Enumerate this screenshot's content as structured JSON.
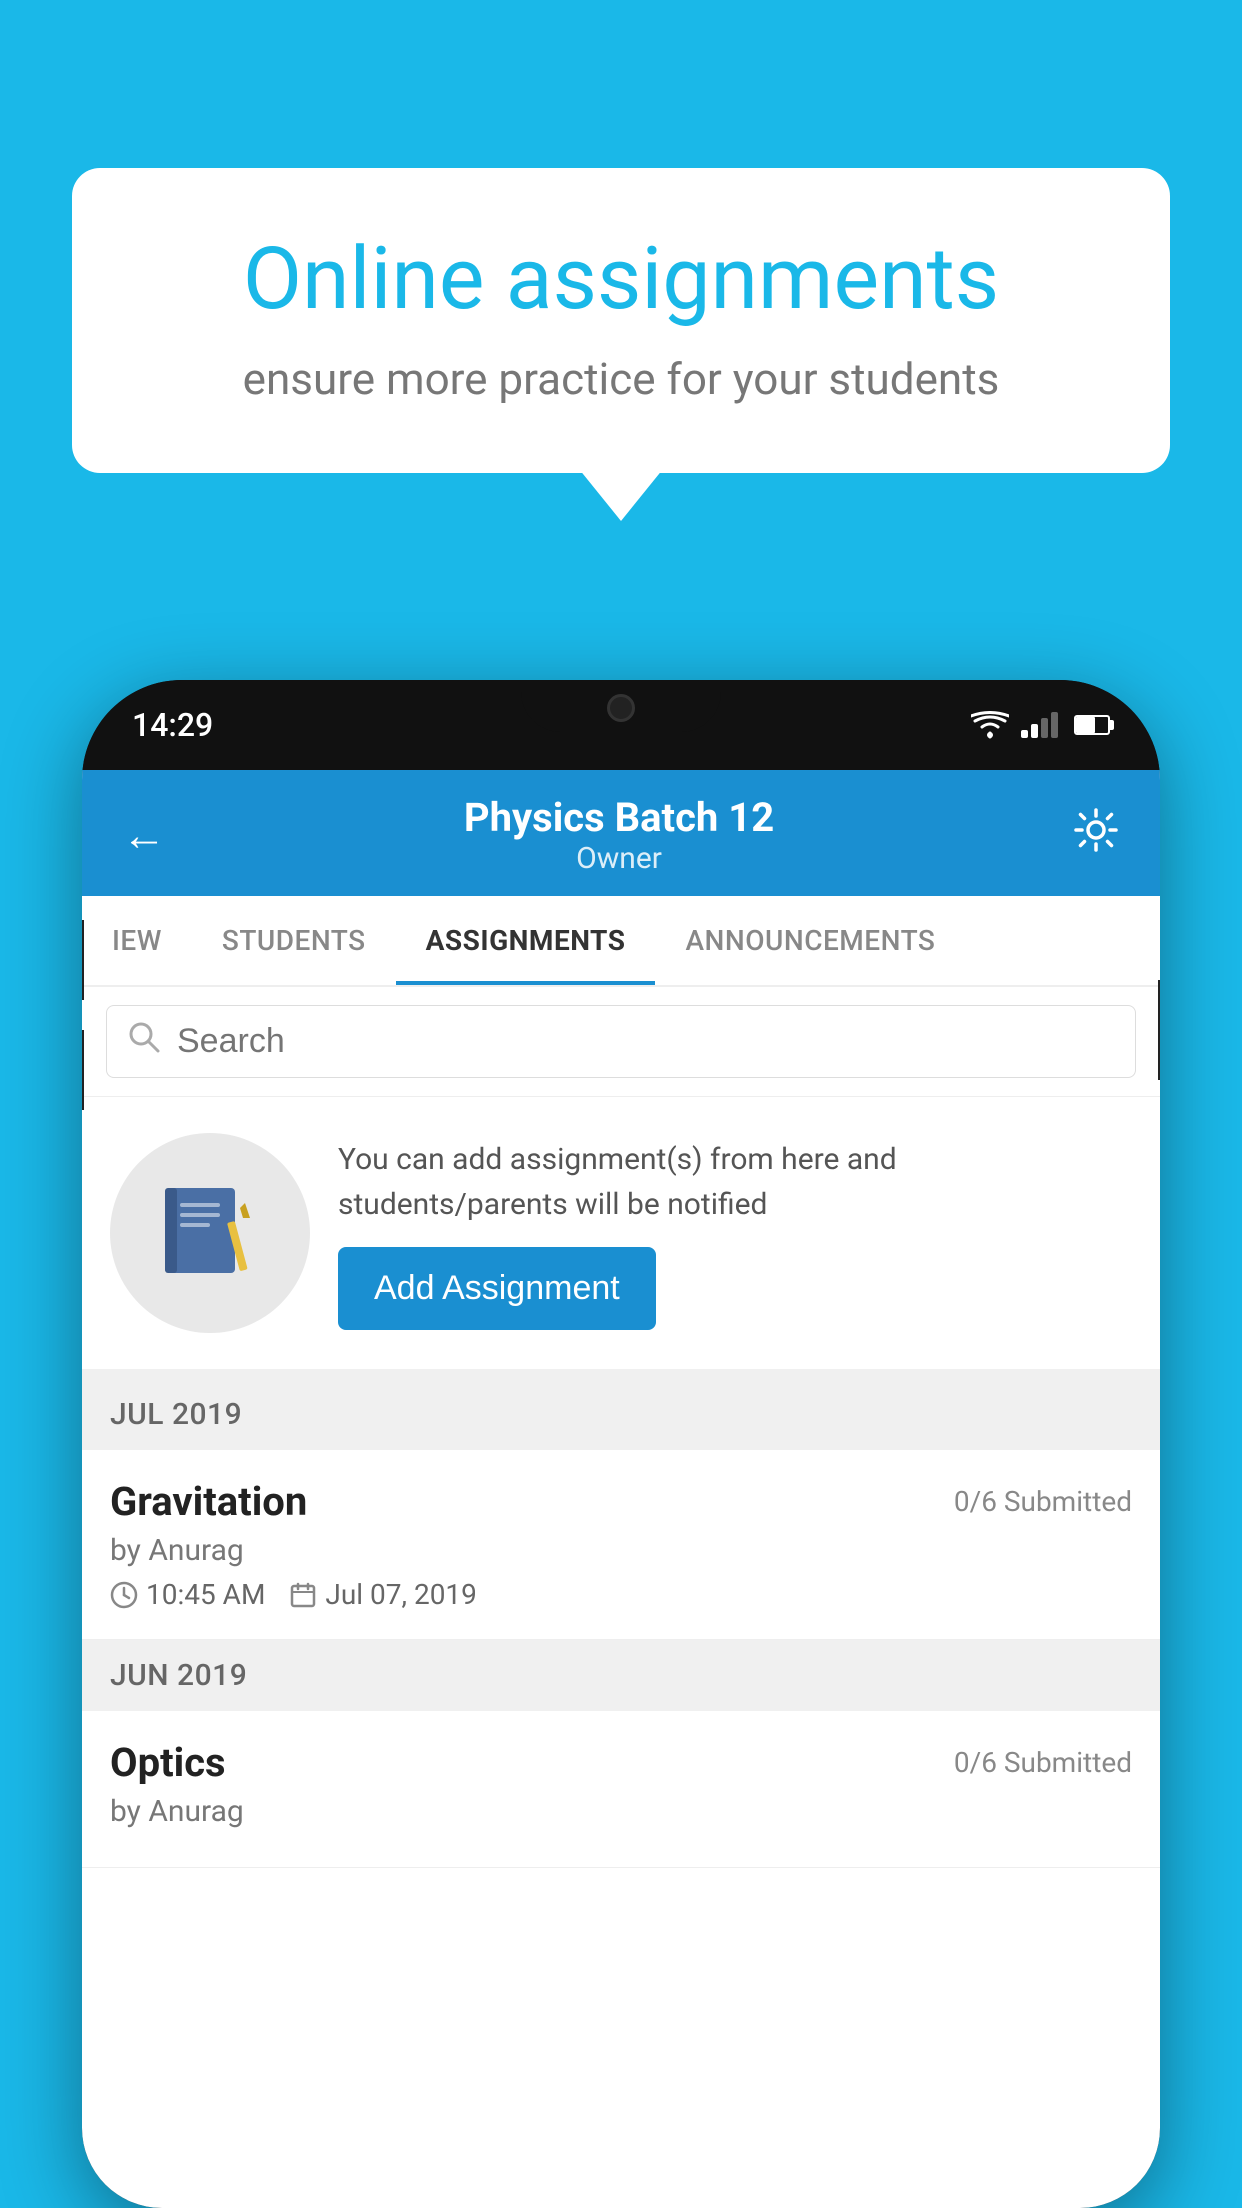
{
  "background_color": "#1ab8e8",
  "speech_bubble": {
    "title": "Online assignments",
    "subtitle": "ensure more practice for your students"
  },
  "phone": {
    "status_bar": {
      "time": "14:29"
    },
    "header": {
      "back_label": "←",
      "title": "Physics Batch 12",
      "subtitle": "Owner",
      "settings_label": "⚙"
    },
    "tabs": [
      {
        "label": "IEW",
        "active": false
      },
      {
        "label": "STUDENTS",
        "active": false
      },
      {
        "label": "ASSIGNMENTS",
        "active": true
      },
      {
        "label": "ANNOUNCEMENTS",
        "active": false
      }
    ],
    "search": {
      "placeholder": "Search"
    },
    "promo": {
      "text": "You can add assignment(s) from here and students/parents will be notified",
      "button_label": "Add Assignment"
    },
    "assignments": [
      {
        "month_label": "JUL 2019",
        "items": [
          {
            "title": "Gravitation",
            "submitted": "0/6 Submitted",
            "author": "by Anurag",
            "time": "10:45 AM",
            "date": "Jul 07, 2019"
          }
        ]
      },
      {
        "month_label": "JUN 2019",
        "items": [
          {
            "title": "Optics",
            "submitted": "0/6 Submitted",
            "author": "by Anurag",
            "time": "",
            "date": ""
          }
        ]
      }
    ]
  }
}
